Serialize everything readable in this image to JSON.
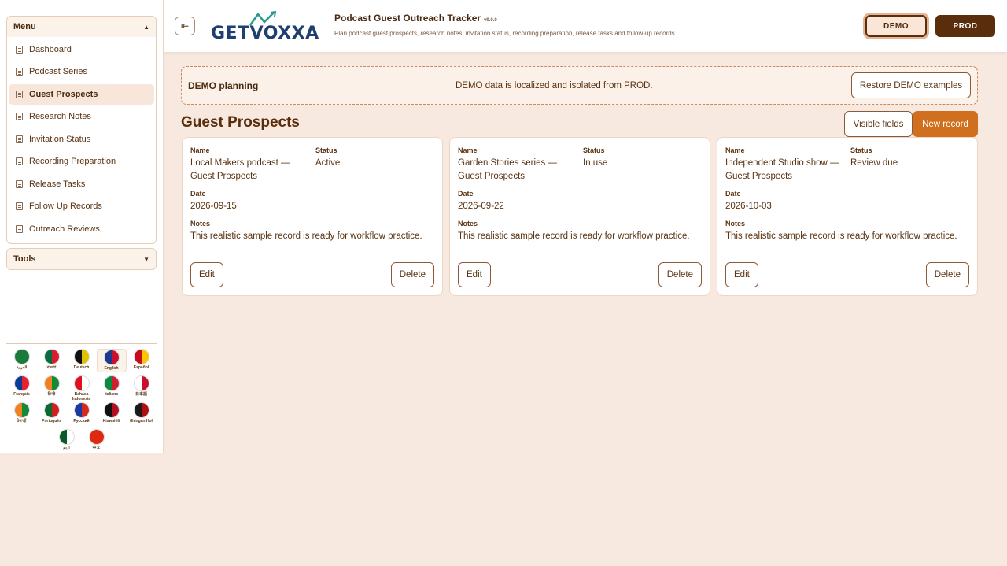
{
  "sidebar": {
    "menu_title": "Menu",
    "menu_items": [
      {
        "label": "Dashboard"
      },
      {
        "label": "Podcast Series"
      },
      {
        "label": "Guest Prospects"
      },
      {
        "label": "Research Notes"
      },
      {
        "label": "Invitation Status"
      },
      {
        "label": "Recording Preparation"
      },
      {
        "label": "Release Tasks"
      },
      {
        "label": "Follow Up Records"
      },
      {
        "label": "Outreach Reviews"
      }
    ],
    "active_item": "Guest Prospects",
    "tools_title": "Tools",
    "languages": [
      {
        "name": "العربية",
        "colors": [
          "#1a7a3a",
          "#1a7a3a"
        ]
      },
      {
        "name": "বাংলা",
        "colors": [
          "#0a6a40",
          "#d62030"
        ]
      },
      {
        "name": "Deutsch",
        "colors": [
          "#111111",
          "#e0c000"
        ]
      },
      {
        "name": "English",
        "colors": [
          "#1f3a8a",
          "#c8102e"
        ]
      },
      {
        "name": "Español",
        "colors": [
          "#c60b1e",
          "#ffc400"
        ]
      },
      {
        "name": "Français",
        "colors": [
          "#0a3a9a",
          "#e52030"
        ]
      },
      {
        "name": "हिन्दी",
        "colors": [
          "#f08020",
          "#128a3a"
        ]
      },
      {
        "name": "Bahasa Indonesia",
        "colors": [
          "#e01020",
          "#ffffff"
        ]
      },
      {
        "name": "Italiano",
        "colors": [
          "#0a8a40",
          "#d02030"
        ]
      },
      {
        "name": "日本語",
        "colors": [
          "#ffffff",
          "#c8102e"
        ]
      },
      {
        "name": "ਪੰਜਾਬੀ",
        "colors": [
          "#f08020",
          "#128a3a"
        ]
      },
      {
        "name": "Português",
        "colors": [
          "#0a6a30",
          "#d02020"
        ]
      },
      {
        "name": "Русский",
        "colors": [
          "#1a3aa0",
          "#d52b1e"
        ]
      },
      {
        "name": "Kiswahili",
        "colors": [
          "#111111",
          "#b01020"
        ]
      },
      {
        "name": "tlhIngan Hol",
        "colors": [
          "#1a1a1a",
          "#b01010"
        ]
      },
      {
        "name": "اردو",
        "colors": [
          "#0a5a2a",
          "#ffffff"
        ]
      },
      {
        "name": "中文",
        "colors": [
          "#de2910",
          "#de2910"
        ]
      }
    ],
    "selected_language": "English"
  },
  "header": {
    "logo_text": "GETVOXXA",
    "app_title": "Podcast Guest Outreach Tracker",
    "app_version": "v9.0.0",
    "app_subtitle": "Plan podcast guest prospects, research notes, invitation status, recording preparation, release tasks and follow-up records",
    "env_demo": "DEMO",
    "env_prod": "PROD"
  },
  "banner": {
    "title": "DEMO planning",
    "message": "DEMO data is localized and isolated from PROD.",
    "restore_label": "Restore DEMO examples"
  },
  "main": {
    "page_title": "Guest Prospects",
    "visible_fields_label": "Visible fields",
    "new_record_label": "New record",
    "labels": {
      "name": "Name",
      "status": "Status",
      "date": "Date",
      "notes": "Notes"
    },
    "edit_label": "Edit",
    "delete_label": "Delete",
    "records": [
      {
        "name": "Local Makers podcast — Guest Prospects",
        "status": "Active",
        "date": "2026-09-15",
        "notes": "This realistic sample record is ready for workflow practice."
      },
      {
        "name": "Garden Stories series — Guest Prospects",
        "status": "In use",
        "date": "2026-09-22",
        "notes": "This realistic sample record is ready for workflow practice."
      },
      {
        "name": "Independent Studio show — Guest Prospects",
        "status": "Review due",
        "date": "2026-10-03",
        "notes": "This realistic sample record is ready for workflow practice."
      }
    ]
  },
  "colors": {
    "accent": "#d0701f",
    "brand_dark": "#5a2e0c",
    "page_bg": "#f7e9df"
  }
}
